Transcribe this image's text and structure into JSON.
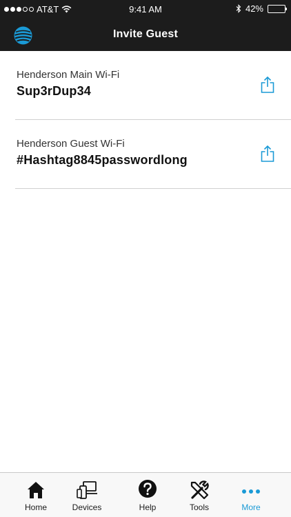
{
  "status_bar": {
    "carrier": "AT&T",
    "time": "9:41 AM",
    "battery": "42%",
    "battery_level": 0.42
  },
  "header": {
    "title": "Invite Guest",
    "logo_icon": "att-globe-icon"
  },
  "networks": [
    {
      "name": "Henderson Main Wi-Fi",
      "password": "Sup3rDup34",
      "action_icon": "share-icon"
    },
    {
      "name": "Henderson Guest Wi-Fi",
      "password": "#Hashtag8845passwordlong",
      "action_icon": "share-icon"
    }
  ],
  "tabs": [
    {
      "label": "Home",
      "icon": "home-icon"
    },
    {
      "label": "Devices",
      "icon": "devices-icon"
    },
    {
      "label": "Help",
      "icon": "help-icon"
    },
    {
      "label": "Tools",
      "icon": "tools-icon"
    },
    {
      "label": "More",
      "icon": "more-icon",
      "active": true
    }
  ],
  "colors": {
    "header_bg": "#1c1c1c",
    "accent": "#1a9ad6",
    "divider": "#d0d0d0"
  }
}
